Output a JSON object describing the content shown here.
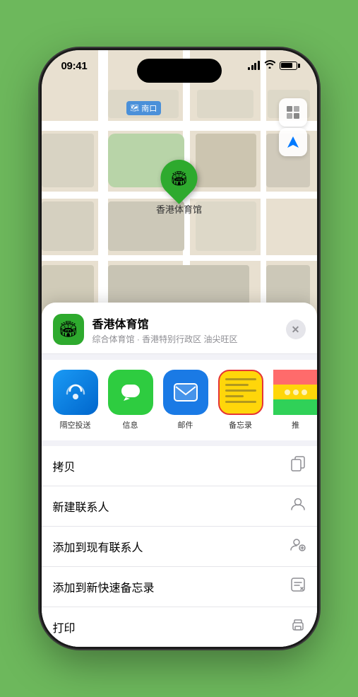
{
  "phone": {
    "time": "09:41",
    "status_icons": {
      "signal": "signal",
      "wifi": "wifi",
      "battery": "battery"
    }
  },
  "map": {
    "label_text": "南口",
    "map_icon": "🗺",
    "location_icon": "🏟",
    "location_label": "香港体育馆",
    "navigate_icon": "➤"
  },
  "venue": {
    "name": "香港体育馆",
    "subtitle": "综合体育馆 · 香港特别行政区 油尖旺区",
    "icon": "🏟",
    "close": "✕"
  },
  "share_actions": [
    {
      "id": "airdrop",
      "label": "隔空投送",
      "icon_type": "airdrop"
    },
    {
      "id": "messages",
      "label": "信息",
      "icon_type": "messages"
    },
    {
      "id": "mail",
      "label": "邮件",
      "icon_type": "mail"
    },
    {
      "id": "notes",
      "label": "备忘录",
      "icon_type": "notes"
    },
    {
      "id": "more",
      "label": "推",
      "icon_type": "more"
    }
  ],
  "menu_items": [
    {
      "label": "拷贝",
      "icon": "copy"
    },
    {
      "label": "新建联系人",
      "icon": "person"
    },
    {
      "label": "添加到现有联系人",
      "icon": "person-add"
    },
    {
      "label": "添加到新快速备忘录",
      "icon": "note"
    },
    {
      "label": "打印",
      "icon": "print"
    }
  ]
}
